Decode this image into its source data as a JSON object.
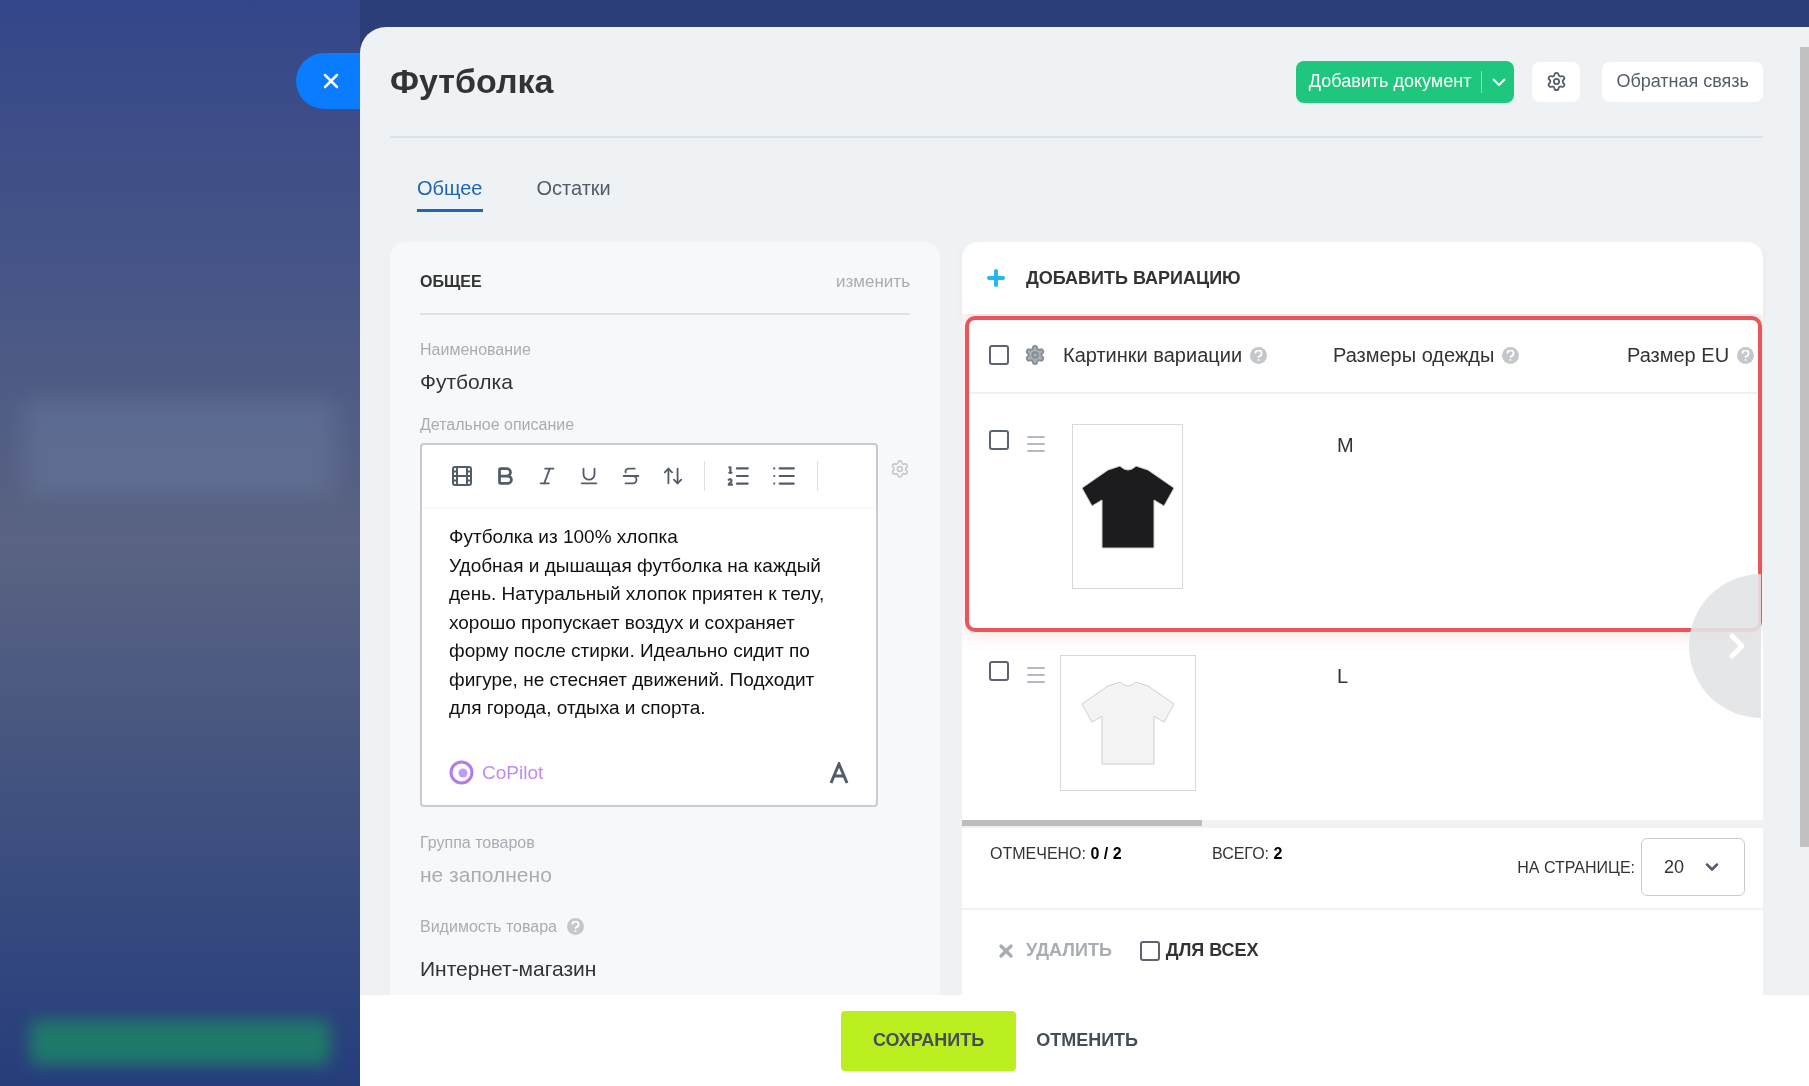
{
  "window": {
    "title": "Футболка"
  },
  "header_buttons": {
    "add_document": "Добавить документ",
    "feedback": "Обратная связь"
  },
  "tabs": [
    {
      "label": "Общее",
      "selected": true
    },
    {
      "label": "Остатки",
      "selected": false
    }
  ],
  "general": {
    "heading": "ОБЩЕЕ",
    "edit_link": "изменить",
    "name": {
      "label": "Наименование",
      "value": "Футболка"
    },
    "description": {
      "label": "Детальное описание",
      "paragraphs": [
        "Футболка из 100% хлопка",
        "Удобная и дышащая футболка на каждый день. Натуральный хлопок приятен к телу, хорошо пропускает воздух и сохраняет форму после стирки. Идеально сидит по фигуре, не стесняет движений. Подходит для города, отдыха и спорта."
      ],
      "copilot": "CoPilot"
    },
    "group": {
      "label": "Группа товаров",
      "value": "не заполнено"
    },
    "visibility": {
      "label": "Видимость товара",
      "help": true,
      "value": "Интернет-магазин"
    }
  },
  "variations": {
    "add_label": "ДОБАВИТЬ ВАРИАЦИЮ",
    "select_all": {
      "checked": false
    },
    "columns": [
      {
        "label": "Картинки вариации",
        "help": true
      },
      {
        "label": "Размеры одежды",
        "help": true
      },
      {
        "label": "Размер EU",
        "help": true
      }
    ],
    "rows": [
      {
        "checked": false,
        "kind": "dark",
        "size": "M"
      },
      {
        "checked": false,
        "kind": "light",
        "size": "L"
      }
    ],
    "scroll": {
      "level": 0.3
    },
    "marked": {
      "label": "ОТМЕЧЕНО:",
      "value": "0 / 2"
    },
    "total": {
      "label": "ВСЕГО:",
      "value": "2"
    },
    "per_page": {
      "label": "НА СТРАНИЦЕ:",
      "value": "20"
    },
    "delete": {
      "label": "УДАЛИТЬ",
      "disabled": true
    },
    "for_all": {
      "label": "ДЛЯ ВСЕХ",
      "checked": false
    }
  },
  "footer": {
    "save": "СОХРАНИТЬ",
    "cancel": "ОТМЕНИТЬ"
  }
}
